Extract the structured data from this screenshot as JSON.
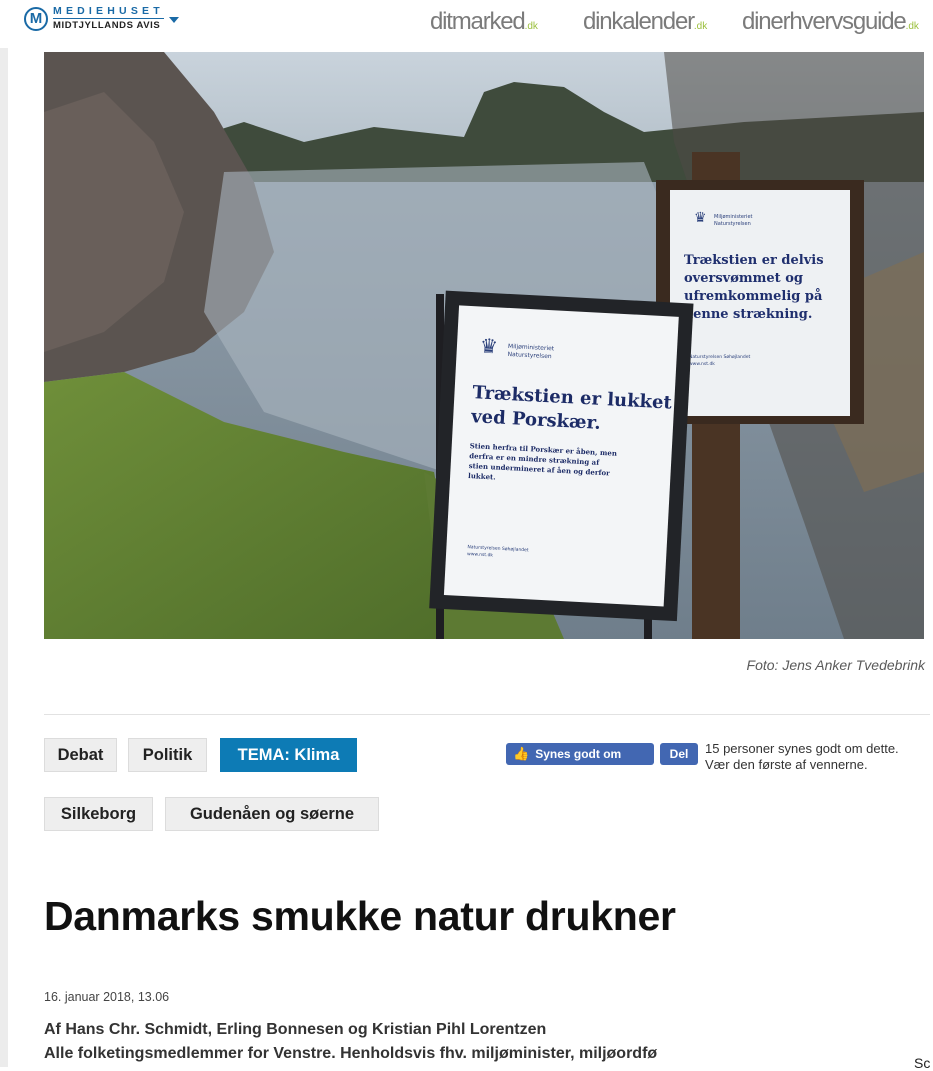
{
  "header": {
    "logo": {
      "top": "MEDIEHUSET",
      "bottom": "MIDTJYLLANDS AVIS",
      "mark": "M"
    },
    "partners": [
      {
        "label": "ditmarked",
        "suffix": ".dk"
      },
      {
        "label": "dinkalender",
        "suffix": ".dk"
      },
      {
        "label": "dinerhvervsguide",
        "suffix": ".dk"
      }
    ]
  },
  "hero": {
    "sign_large": {
      "ministry": "Miljøministeriet",
      "agency": "Naturstyrelsen",
      "title_line1": "Trækstien er lukket",
      "title_line2": "ved Porskær.",
      "body_line1": "Stien herfra til Porskær er åben, men",
      "body_line2": "derfra er en mindre strækning af",
      "body_line3": "stien  undermineret af åen og derfor",
      "body_line4": "lukket.",
      "footer_line1": "Naturstyrelsen Søhøjlandet",
      "footer_line2": "www.nst.dk"
    },
    "sign_small": {
      "ministry": "Miljøministeriet",
      "agency": "Naturstyrelsen",
      "line1": "Trækstien er delvis",
      "line2": "oversvømmet og",
      "line3": "ufremkommelig på",
      "line4": "denne strækning.",
      "footer_line1": "Naturstyrelsen Søhøjlandet",
      "footer_line2": "www.nst.dk"
    },
    "caption": "Foto: Jens Anker Tvedebrink"
  },
  "tags": {
    "debat": "Debat",
    "politik": "Politik",
    "tema": "TEMA: Klima",
    "silkeborg": "Silkeborg",
    "gudenaaen": "Gudenåen og søerne"
  },
  "facebook": {
    "like_label": "Synes godt om",
    "share_label": "Del",
    "text": "15 personer synes godt om dette. Vær den første af vennerne."
  },
  "article": {
    "headline": "Danmarks smukke natur drukner",
    "date": "16. januar 2018, 13.06",
    "authors": "Af Hans Chr. Schmidt, Erling Bonnesen og Kristian Pihl Lorentzen",
    "roles": "Alle folketingsmedlemmer for Venstre. Henholdsvis fhv. miljøminister, miljøordfø"
  },
  "corner_text": "Sc",
  "colors": {
    "accent": "#0d7bb5",
    "facebook": "#4267b2",
    "brand": "#1a6aa6"
  }
}
